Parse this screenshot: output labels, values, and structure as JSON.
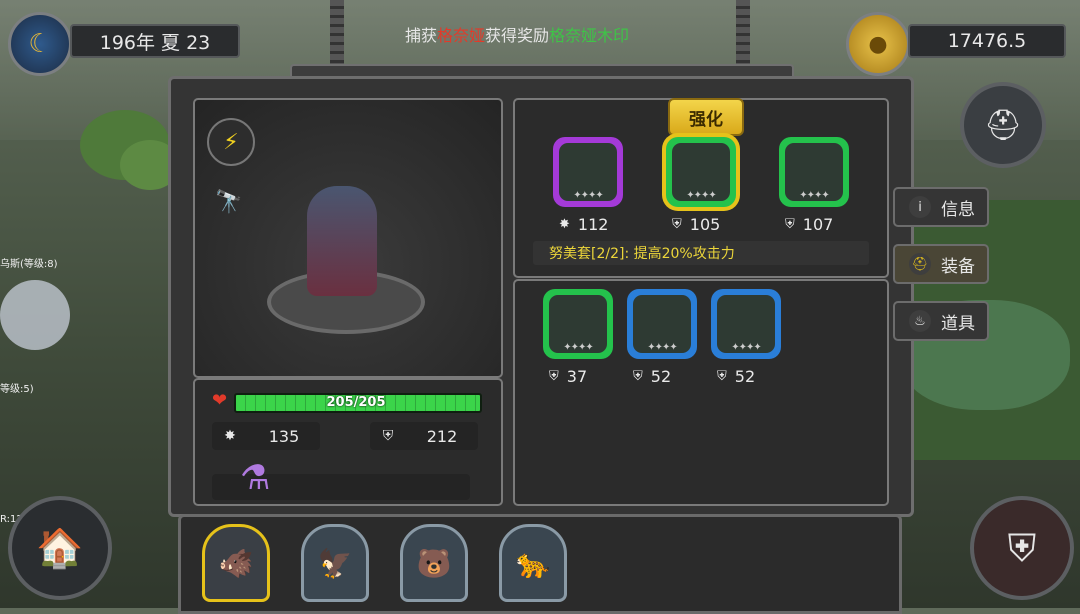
{
  "header": {
    "date_text": "196年 夏 23",
    "message_prefix": "捕获",
    "message_target": "格奈娅",
    "message_middle": "获得奖励",
    "message_reward": "格奈娅木印",
    "gold_value": "17476.5"
  },
  "side_labels": {
    "left_label_1": "乌斯(等级:8)",
    "left_label_2": "等级:5)",
    "left_label_3": "R:12"
  },
  "hero": {
    "hp_text": "205/205",
    "hp_fraction": 1.0,
    "attack": "135",
    "defense": "212"
  },
  "equipment": {
    "enhance_label": "强化",
    "equipped": [
      {
        "rarity": "purple",
        "stat_icon": "attack-icon",
        "value": "112"
      },
      {
        "rarity": "green",
        "stat_icon": "defense-icon",
        "value": "105",
        "selected": true
      },
      {
        "rarity": "green",
        "stat_icon": "defense-icon",
        "value": "107"
      }
    ],
    "set_bonus": "努美套[2/2]: 提高20%攻击力",
    "inventory": [
      {
        "rarity": "green",
        "stat_icon": "defense-icon",
        "value": "37"
      },
      {
        "rarity": "blue",
        "stat_icon": "defense-icon",
        "value": "52"
      },
      {
        "rarity": "blue",
        "stat_icon": "defense-icon",
        "value": "52"
      }
    ]
  },
  "tabs": [
    {
      "label": "信息",
      "icon": "info-icon",
      "active": false
    },
    {
      "label": "装备",
      "icon": "helmet-icon",
      "active": true
    },
    {
      "label": "道具",
      "icon": "potion-bag-icon",
      "active": false
    }
  ],
  "party": [
    {
      "name": "warthog",
      "icon": "warthog-portrait-icon",
      "selected": true
    },
    {
      "name": "eagle",
      "icon": "eagle-portrait-icon",
      "selected": false
    },
    {
      "name": "polar-bear",
      "icon": "polar-bear-portrait-icon",
      "selected": false
    },
    {
      "name": "leopard",
      "icon": "leopard-portrait-icon",
      "selected": false
    }
  ],
  "colors": {
    "purple": "#a43ad8",
    "green": "#24c24c",
    "blue": "#2a7ed8",
    "gold": "#e6c21a",
    "hp_green": "#3bd44a",
    "message_red": "#e23a2a",
    "message_green": "#3ec447",
    "set_text": "#ecd63a"
  }
}
